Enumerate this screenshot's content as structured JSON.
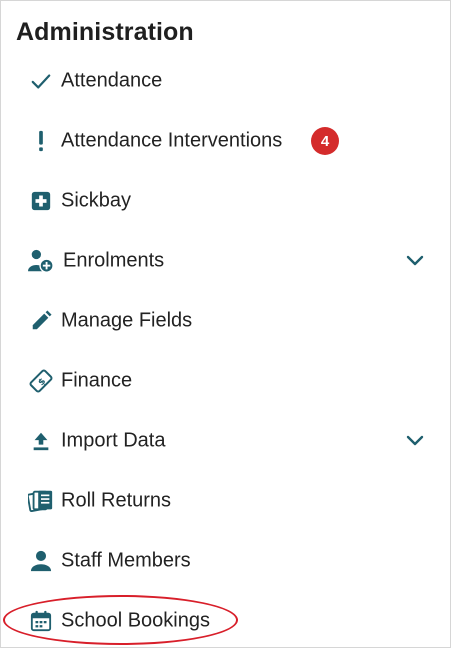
{
  "sidebar": {
    "title": "Administration",
    "accent_color": "#1f5f6e",
    "badge_color": "#d42b2b",
    "items": [
      {
        "label": "Attendance",
        "icon": "check-icon"
      },
      {
        "label": "Attendance Interventions",
        "icon": "exclamation-icon",
        "badge": "4"
      },
      {
        "label": "Sickbay",
        "icon": "medical-cross-icon"
      },
      {
        "label": "Enrolments",
        "icon": "add-user-icon",
        "expandable": true
      },
      {
        "label": "Manage Fields",
        "icon": "pencil-icon"
      },
      {
        "label": "Finance",
        "icon": "money-tag-icon"
      },
      {
        "label": "Import Data",
        "icon": "upload-icon",
        "expandable": true
      },
      {
        "label": "Roll Returns",
        "icon": "documents-icon"
      },
      {
        "label": "Staff Members",
        "icon": "person-icon"
      },
      {
        "label": "School Bookings",
        "icon": "calendar-icon",
        "highlighted": true
      }
    ]
  }
}
